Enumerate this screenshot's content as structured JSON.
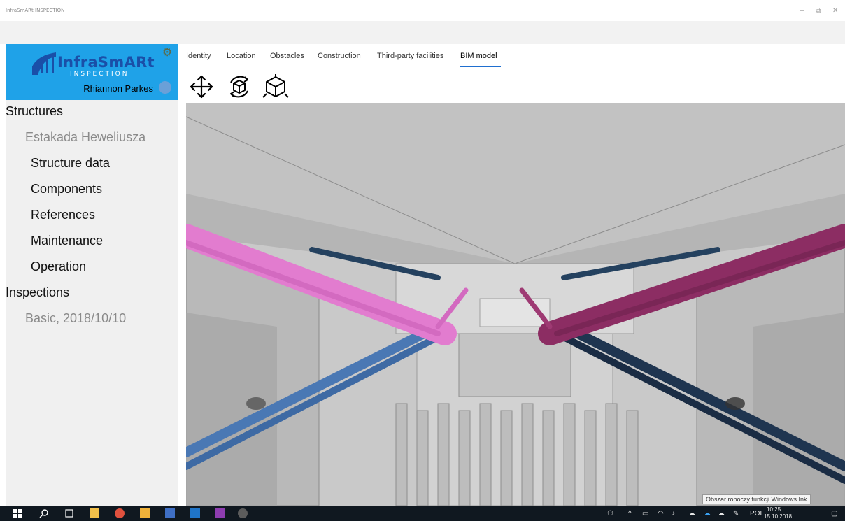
{
  "window": {
    "title": "InfraSmARt INSPECTION",
    "minimize_glyph": "–",
    "restore_glyph": "⧉",
    "close_glyph": "✕"
  },
  "brand": {
    "name": "InfraSmARt",
    "subtitle": "INSPECTION",
    "user_name": "Rhiannon Parkes",
    "color": "#1fa2e8"
  },
  "sidebar": {
    "structures_header": "Structures",
    "structure_name": "Estakada Heweliusza",
    "items": [
      {
        "label": "Structure data"
      },
      {
        "label": "Components"
      },
      {
        "label": "References"
      },
      {
        "label": "Maintenance"
      },
      {
        "label": "Operation"
      }
    ],
    "inspections_header": "Inspections",
    "inspection_item": "Basic, 2018/10/10"
  },
  "tabs": [
    {
      "label": "Identity"
    },
    {
      "label": "Location"
    },
    {
      "label": "Obstacles"
    },
    {
      "label": "Construction"
    },
    {
      "label": "Third-party facilities"
    },
    {
      "label": "BIM model",
      "active": true
    }
  ],
  "tools": [
    {
      "icon": "move-arrows-icon"
    },
    {
      "icon": "orbit-cube-icon"
    },
    {
      "icon": "perspective-cube-icon"
    }
  ],
  "taskbar": {
    "tooltip": "Obszar roboczy funkcji Windows Ink",
    "language": "POL",
    "time": "10:25",
    "date": "15.10.2018"
  },
  "colors": {
    "accent": "#1f6fd0",
    "pink_pipe": "#e27ccf",
    "dark_pink_pipe": "#8c2d63",
    "blue_pipe": "#4a78b4"
  }
}
